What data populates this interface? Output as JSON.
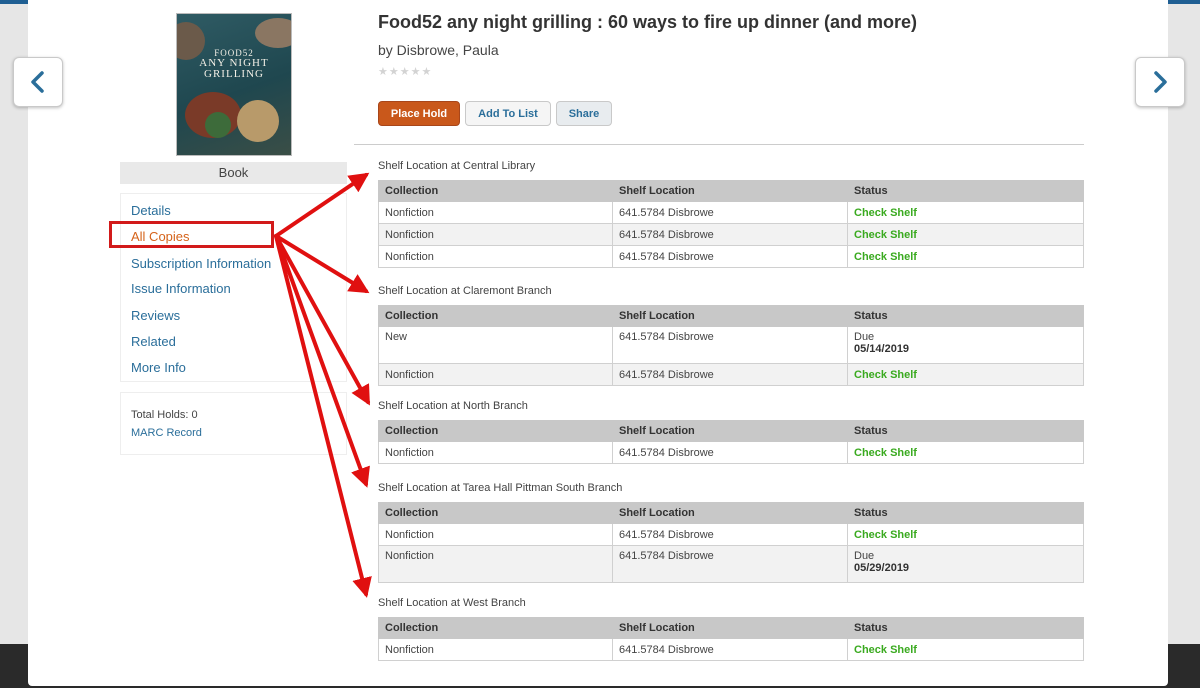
{
  "book": {
    "title": "Food52 any night grilling : 60 ways to fire up dinner (and more)",
    "author": "by Disbrowe, Paula",
    "rating_stars": "★★★★★",
    "format": "Book",
    "cover": {
      "brand": "FOOD52",
      "title_line1": "ANY NIGHT",
      "title_line2": "GRILLING"
    }
  },
  "nav": {
    "prev_icon": "chevron-left-icon",
    "next_icon": "chevron-right-icon"
  },
  "actions": {
    "place_hold": "Place Hold",
    "add_to_list": "Add To List",
    "share": "Share"
  },
  "sidebar": {
    "items": [
      {
        "label": "Details"
      },
      {
        "label": "All Copies",
        "active": true
      },
      {
        "label": "Subscription Information"
      },
      {
        "label": "Issue Information"
      },
      {
        "label": "Reviews"
      },
      {
        "label": "Related"
      },
      {
        "label": "More Info"
      }
    ],
    "total_holds": "Total Holds: 0",
    "marc_record": "MARC Record"
  },
  "columns": {
    "collection": "Collection",
    "shelf_location": "Shelf Location",
    "status": "Status"
  },
  "locations": [
    {
      "title": "Shelf Location at Central Library",
      "rows": [
        {
          "collection": "Nonfiction",
          "shelf": "641.5784 Disbrowe",
          "status": "Check Shelf"
        },
        {
          "collection": "Nonfiction",
          "shelf": "641.5784 Disbrowe",
          "status": "Check Shelf"
        },
        {
          "collection": "Nonfiction",
          "shelf": "641.5784 Disbrowe",
          "status": "Check Shelf"
        }
      ]
    },
    {
      "title": "Shelf Location at Claremont Branch",
      "rows": [
        {
          "collection": "New",
          "shelf": "641.5784 Disbrowe",
          "status": "Due",
          "due": "05/14/2019"
        },
        {
          "collection": "Nonfiction",
          "shelf": "641.5784 Disbrowe",
          "status": "Check Shelf"
        }
      ]
    },
    {
      "title": "Shelf Location at North Branch",
      "rows": [
        {
          "collection": "Nonfiction",
          "shelf": "641.5784 Disbrowe",
          "status": "Check Shelf"
        }
      ]
    },
    {
      "title": "Shelf Location at Tarea Hall Pittman South Branch",
      "rows": [
        {
          "collection": "Nonfiction",
          "shelf": "641.5784 Disbrowe",
          "status": "Check Shelf"
        },
        {
          "collection": "Nonfiction",
          "shelf": "641.5784 Disbrowe",
          "status": "Due",
          "due": "05/29/2019"
        }
      ]
    },
    {
      "title": "Shelf Location at West Branch",
      "rows": [
        {
          "collection": "Nonfiction",
          "shelf": "641.5784 Disbrowe",
          "status": "Check Shelf"
        }
      ]
    }
  ],
  "colors": {
    "accent": "#c9581b",
    "link": "#2a6e9a",
    "status_ok": "#3aaa1f",
    "highlight": "#d21a1a"
  }
}
